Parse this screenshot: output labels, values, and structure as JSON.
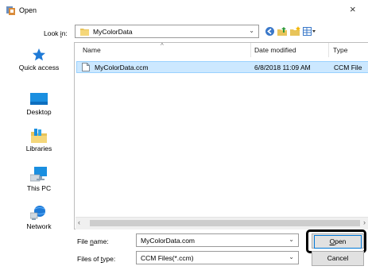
{
  "title_bar": {
    "title": "Open",
    "close_glyph": "×"
  },
  "look_in": {
    "label": "Look in:",
    "value": "MyColorData"
  },
  "places": [
    {
      "label": "Quick access",
      "icon": "quick-access-icon"
    },
    {
      "label": "Desktop",
      "icon": "desktop-icon"
    },
    {
      "label": "Libraries",
      "icon": "libraries-icon"
    },
    {
      "label": "This PC",
      "icon": "this-pc-icon"
    },
    {
      "label": "Network",
      "icon": "network-icon"
    }
  ],
  "file_list": {
    "columns": [
      "Name",
      "Date modified",
      "Type"
    ],
    "rows": [
      {
        "name": "MyColorData.ccm",
        "date_modified": "6/8/2018 11:09 AM",
        "type": "CCM File"
      }
    ]
  },
  "file_name": {
    "label": "File name:",
    "value": "MyColorData.com"
  },
  "file_type": {
    "label": "Files of type:",
    "value": "CCM Files(*.ccm)"
  },
  "buttons": {
    "open": "Open",
    "cancel": "Cancel"
  },
  "colors": {
    "selection": "#cce8ff",
    "selection_border": "#99d1ff",
    "accent": "#0078d7"
  }
}
